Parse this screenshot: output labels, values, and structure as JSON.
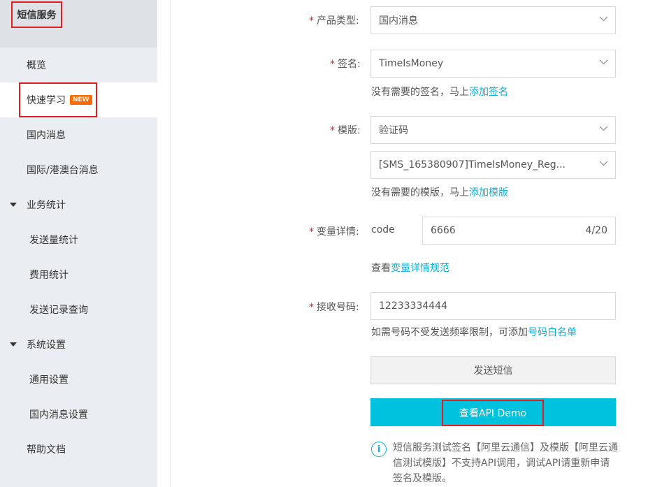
{
  "sidebar": {
    "title": "短信服务",
    "items": [
      {
        "label": "概览"
      },
      {
        "label": "快速学习",
        "badge": "NEW"
      },
      {
        "label": "国内消息"
      },
      {
        "label": "国际/港澳台消息"
      },
      {
        "label": "业务统计",
        "expanded": true
      },
      {
        "label": "发送量统计"
      },
      {
        "label": "费用统计"
      },
      {
        "label": "发送记录查询"
      },
      {
        "label": "系统设置",
        "expanded": true
      },
      {
        "label": "通用设置"
      },
      {
        "label": "国内消息设置"
      },
      {
        "label": "帮助文档"
      }
    ]
  },
  "form": {
    "product_type": {
      "label": "产品类型:",
      "value": "国内消息"
    },
    "signature": {
      "label": "签名:",
      "value": "TimeIsMoney",
      "hint": "没有需要的签名，马上",
      "hint_link": "添加签名"
    },
    "template": {
      "label": "模版:",
      "type_value": "验证码",
      "value": "[SMS_165380907]TimeIsMoney_Reg...",
      "hint": "没有需要的模版，马上",
      "hint_link": "添加模版"
    },
    "variables": {
      "label": "变量详情:",
      "var_name": "code",
      "value": "6666",
      "counter": "4/20",
      "hint": "查看",
      "hint_link": "变量详情规范"
    },
    "phone": {
      "label": "接收号码:",
      "value": "12233334444",
      "hint": "如需号码不受发送频率限制，可添加",
      "hint_link": "号码白名单"
    },
    "send_button": "发送短信",
    "demo_button": "查看API Demo",
    "info_icon_glyph": "i",
    "notice": "短信服务测试签名【阿里云通信】及模版【阿里云通信测试模版】不支持API调用，调试API请重新申请签名及模版。"
  },
  "colors": {
    "accent": "#00c1de",
    "link": "#0ab0d8",
    "highlight": "#e02020",
    "badge": "#ff6a00"
  },
  "icons": {
    "select_chevron": "chevron-down-icon",
    "group_caret": "caret-down-icon",
    "info": "info-icon"
  }
}
